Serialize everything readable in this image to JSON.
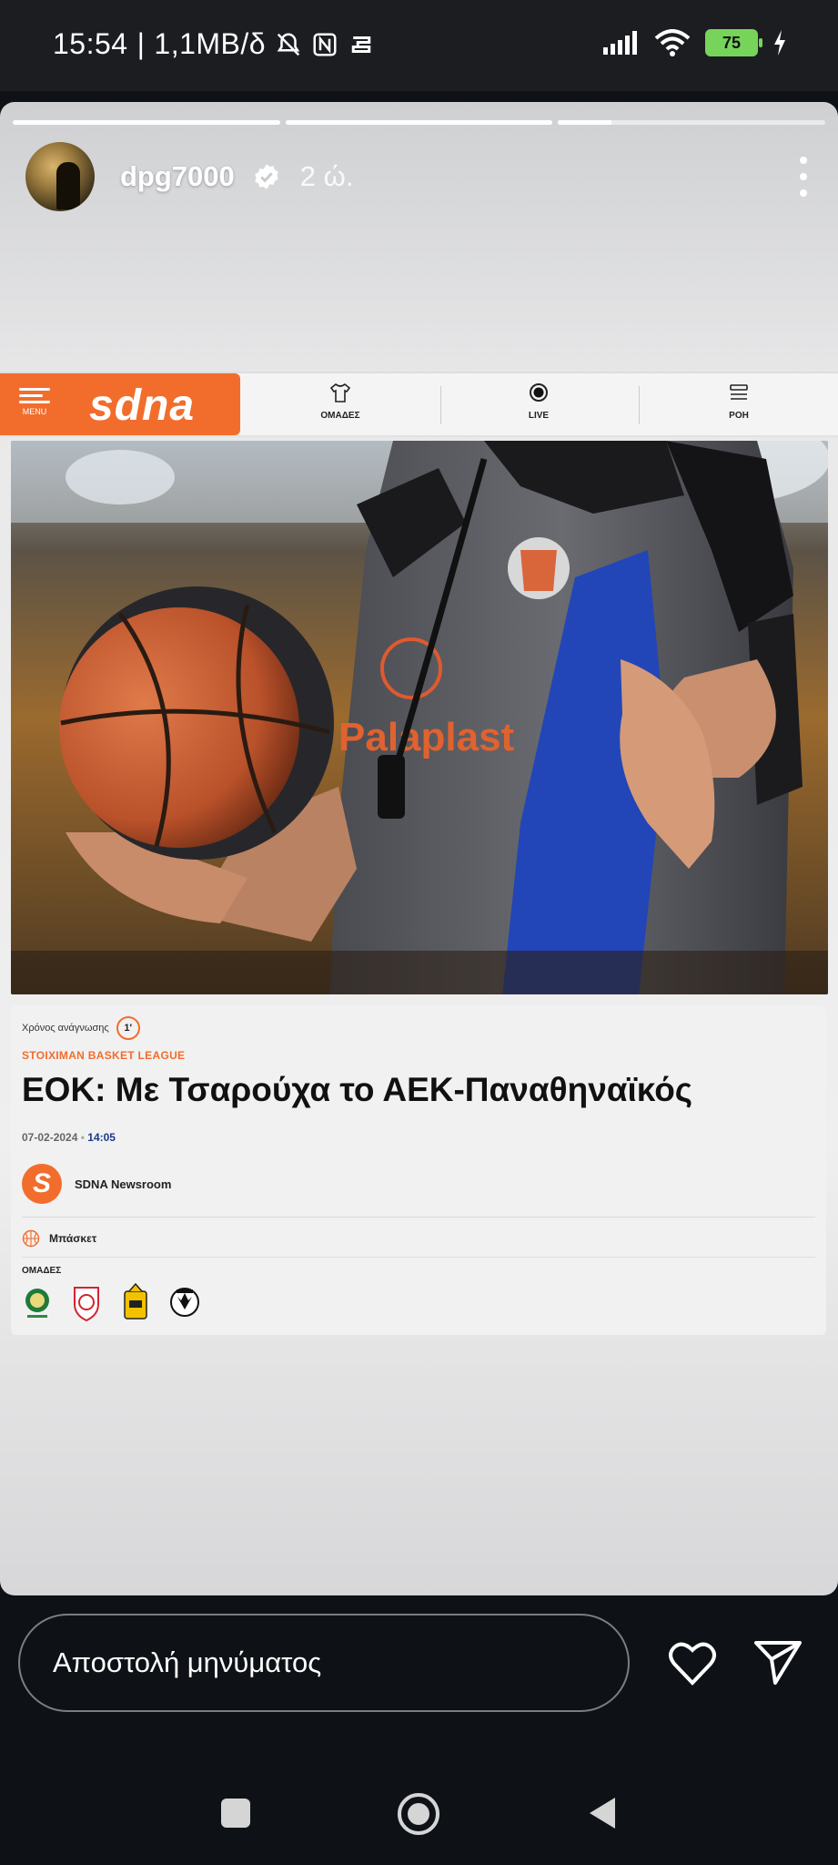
{
  "status_bar": {
    "time": "15:54",
    "network_speed": "1,1MB/δ",
    "battery_level": "75",
    "icons": [
      "bell-off-icon",
      "nfc-icon",
      "cast-icon",
      "signal-icon",
      "wifi-icon",
      "battery-icon",
      "charging-icon"
    ]
  },
  "story": {
    "progress_segments": [
      1.0,
      1.0,
      0.2
    ],
    "username": "dpg7000",
    "posted_ago": "2 ώ.",
    "verified": true
  },
  "article": {
    "site_logo": "SDNA",
    "menu_label": "MENU",
    "nav": [
      {
        "label": "ΟΜΑΔΕΣ",
        "icon": "shirt-icon"
      },
      {
        "label": "LIVE",
        "icon": "live-dot-icon"
      },
      {
        "label": "ΡΟΗ",
        "icon": "feed-icon"
      }
    ],
    "read_time_label": "Χρόνος ανάγνωσης",
    "read_time_value": "1'",
    "category": "STOIXIMAN BASKET LEAGUE",
    "headline": "ΕΟΚ: Με Τσαρούχα το ΑΕΚ-Παναθηναϊκός",
    "date": "07-02-2024",
    "time": "14:05",
    "author": "SDNA Newsroom",
    "author_logo": "S",
    "sport": "Μπάσκετ",
    "teams_label": "ΟΜΑΔΕΣ",
    "teams": [
      "panathinaikos-logo",
      "olympiacos-logo",
      "aris-logo",
      "paok-logo"
    ]
  },
  "reply": {
    "placeholder": "Αποστολή μηνύματος"
  },
  "colors": {
    "accent": "#f26d2c",
    "status_bar_bg": "#1b1d21",
    "app_bg": "#0e1116"
  }
}
